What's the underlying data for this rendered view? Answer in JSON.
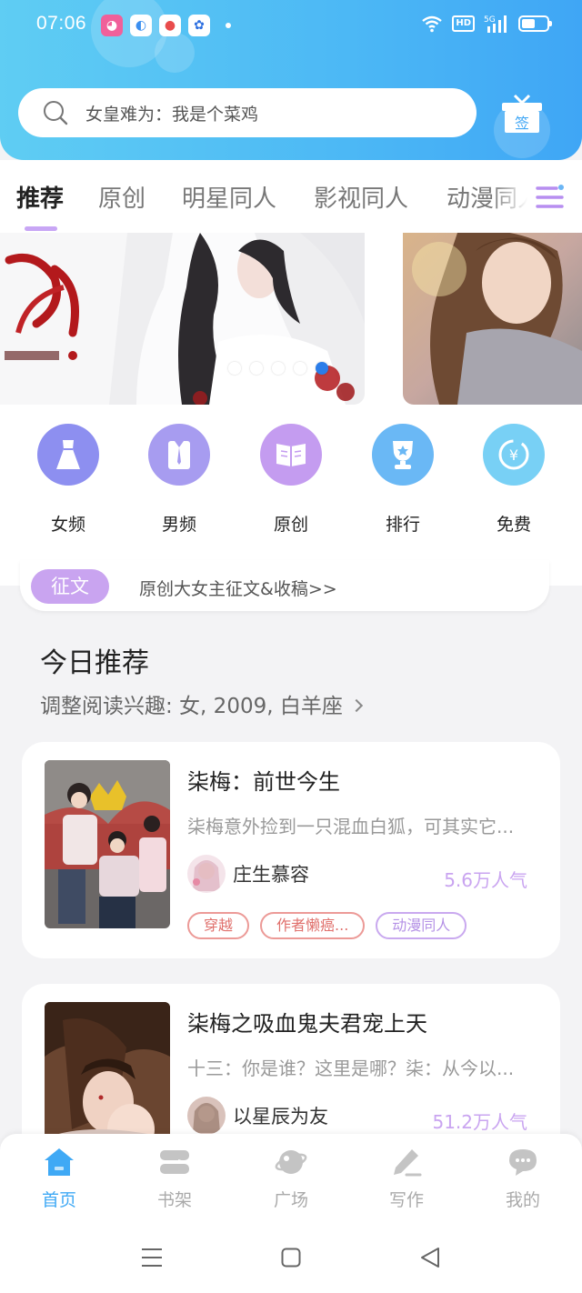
{
  "status_bar": {
    "time": "07:06",
    "network": "5G",
    "hd": "HD"
  },
  "search": {
    "text": "女皇难为：我是个菜鸡"
  },
  "checkin": {
    "label": "签"
  },
  "tabs": [
    {
      "label": "推荐",
      "active": true
    },
    {
      "label": "原创"
    },
    {
      "label": "明星同人"
    },
    {
      "label": "影视同人"
    },
    {
      "label": "动漫同人"
    }
  ],
  "banner": {
    "dots": 5,
    "active_dot": 5
  },
  "categories": [
    {
      "label": "女频",
      "icon": "dress-icon",
      "color": "#8d8ff0"
    },
    {
      "label": "男频",
      "icon": "shirt-icon",
      "color": "#a79cf0"
    },
    {
      "label": "原创",
      "icon": "book-icon",
      "color": "#c49cf0"
    },
    {
      "label": "排行",
      "icon": "trophy-icon",
      "color": "#6ab8f5"
    },
    {
      "label": "免费",
      "icon": "coin-icon",
      "color": "#78d0f5"
    }
  ],
  "notice": {
    "tag": "征文",
    "text": "原创大女主征文&收稿>>"
  },
  "today": {
    "title": "今日推荐",
    "subtitle": "调整阅读兴趣: 女, 2009, 白羊座"
  },
  "books": [
    {
      "title": "柒梅：前世今生",
      "desc": "柒梅意外捡到一只混血白狐，可其实它...",
      "author": "庄生慕容",
      "popularity": "5.6万人气",
      "tags": [
        "穿越",
        "作者懒癌...",
        "动漫同人"
      ]
    },
    {
      "title": "柒梅之吸血鬼夫君宠上天",
      "desc": "十三：你是谁？这里是哪？柒：从今以...",
      "author": "以星辰为友",
      "popularity": "51.2万人气",
      "tags": []
    }
  ],
  "bottom_nav": [
    {
      "label": "首页",
      "icon": "home-icon",
      "active": true
    },
    {
      "label": "书架",
      "icon": "bookshelf-icon"
    },
    {
      "label": "广场",
      "icon": "planet-icon"
    },
    {
      "label": "写作",
      "icon": "pen-icon"
    },
    {
      "label": "我的",
      "icon": "chat-icon"
    }
  ],
  "colors": {
    "accent": "#3fa9f5",
    "purple": "#c9a4f0",
    "tag_red": "#e0706c"
  }
}
